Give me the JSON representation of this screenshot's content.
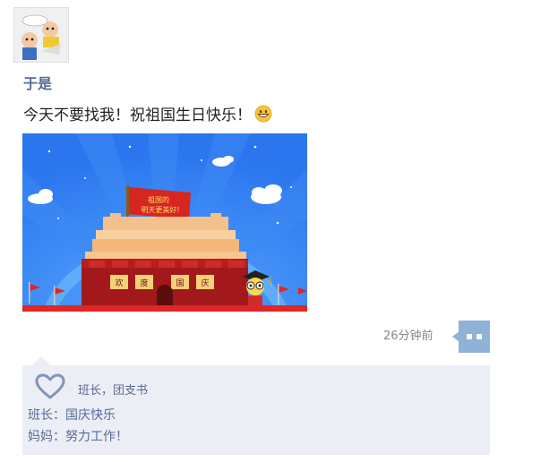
{
  "post": {
    "author": "于是",
    "text": "今天不要找我！祝祖国生日快乐！",
    "emoji": "grinning-face-emoji",
    "image": {
      "banner_line1": "祖国的",
      "banner_line2": "明天更美好!",
      "gate_chars": [
        "欢",
        "度",
        "国",
        "庆"
      ]
    },
    "timestamp": "26分钟前"
  },
  "likes": {
    "names": "班长，团支书"
  },
  "comments": [
    {
      "author": "班长",
      "separator": "：",
      "text": "国庆快乐"
    },
    {
      "author": "妈妈",
      "separator": "：",
      "text": "努力工作！"
    }
  ],
  "colors": {
    "link_blue": "#576b95",
    "comment_bg": "#eceef5",
    "more_button": "#8fb2d9",
    "sky": "#2f7cf0"
  },
  "icons": {
    "more": "ellipsis-bubble-icon",
    "like": "heart-outline-icon"
  }
}
